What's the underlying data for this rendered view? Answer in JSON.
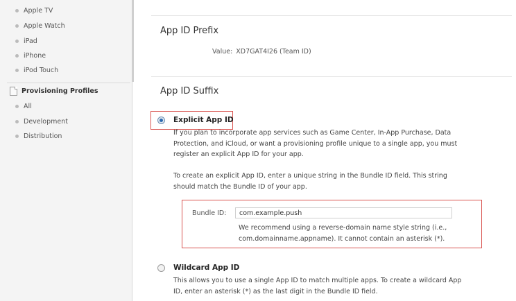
{
  "sidebar": {
    "items": [
      {
        "label": "Apple TV"
      },
      {
        "label": "Apple Watch"
      },
      {
        "label": "iPad"
      },
      {
        "label": "iPhone"
      },
      {
        "label": "iPod Touch"
      }
    ],
    "provisioning": {
      "title": "Provisioning Profiles",
      "items": [
        {
          "label": "All"
        },
        {
          "label": "Development"
        },
        {
          "label": "Distribution"
        }
      ]
    }
  },
  "prefix": {
    "heading": "App ID Prefix",
    "value_label": "Value:",
    "value": "XD7GAT4I26 (Team ID)"
  },
  "suffix": {
    "heading": "App ID Suffix",
    "explicit": {
      "title": "Explicit App ID",
      "selected": true,
      "desc_lines": [
        "If you plan to incorporate app services such as Game Center, In-App Purchase, Data",
        "Protection, and iCloud, or want a provisioning profile unique to a single app, you must",
        "register an explicit App ID for your app."
      ],
      "create_lines": [
        "To create an explicit App ID, enter a unique string in the Bundle ID field. This string",
        "should match the Bundle ID of your app."
      ],
      "bundle_label": "Bundle ID:",
      "bundle_value": "com.example.push",
      "bundle_help_lines": [
        "We recommend using a reverse-domain name style string (i.e.,",
        "com.domainname.appname). It cannot contain an asterisk (*)."
      ]
    },
    "wildcard": {
      "title": "Wildcard App ID",
      "selected": false,
      "desc_lines": [
        "This allows you to use a single App ID to match multiple apps. To create a wildcard App",
        "ID, enter an asterisk (*) as the last digit in the Bundle ID field."
      ]
    }
  },
  "colors": {
    "highlight": "#d9534f",
    "radio_selected": "#2c6ab0"
  }
}
